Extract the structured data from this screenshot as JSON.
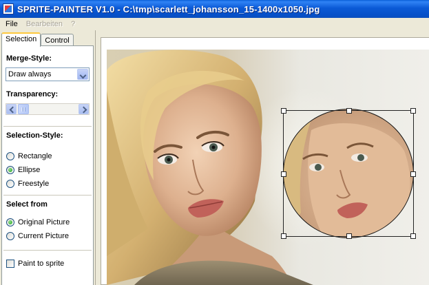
{
  "window": {
    "title": "SPRITE-PAINTER V1.0 - C:\\tmp\\scarlett_johansson_15-1400x1050.jpg"
  },
  "menu": {
    "items": [
      {
        "label": "File",
        "enabled": true
      },
      {
        "label": "Bearbeiten",
        "enabled": false
      },
      {
        "label": "?",
        "enabled": false
      }
    ]
  },
  "tabs": [
    {
      "label": "Selection",
      "active": true
    },
    {
      "label": "Control",
      "active": false
    }
  ],
  "panel": {
    "merge_style": {
      "label": "Merge-Style:",
      "selected": "Draw always"
    },
    "transparency": {
      "label": "Transparency:"
    },
    "selection_style": {
      "label": "Selection-Style:",
      "options": [
        "Rectangle",
        "Ellipse",
        "Freestyle"
      ],
      "selected": "Ellipse"
    },
    "select_from": {
      "label": "Select from",
      "options": [
        "Original Picture",
        "Current Picture"
      ],
      "selected": "Original Picture"
    },
    "paint_to_sprite": {
      "label": "Paint to sprite",
      "checked": false
    }
  },
  "colors": {
    "titlebar": "#0a5fd8",
    "window_bg": "#ece9d8",
    "tab_highlight": "#ffc83c",
    "radio_selected": "#21a121"
  }
}
